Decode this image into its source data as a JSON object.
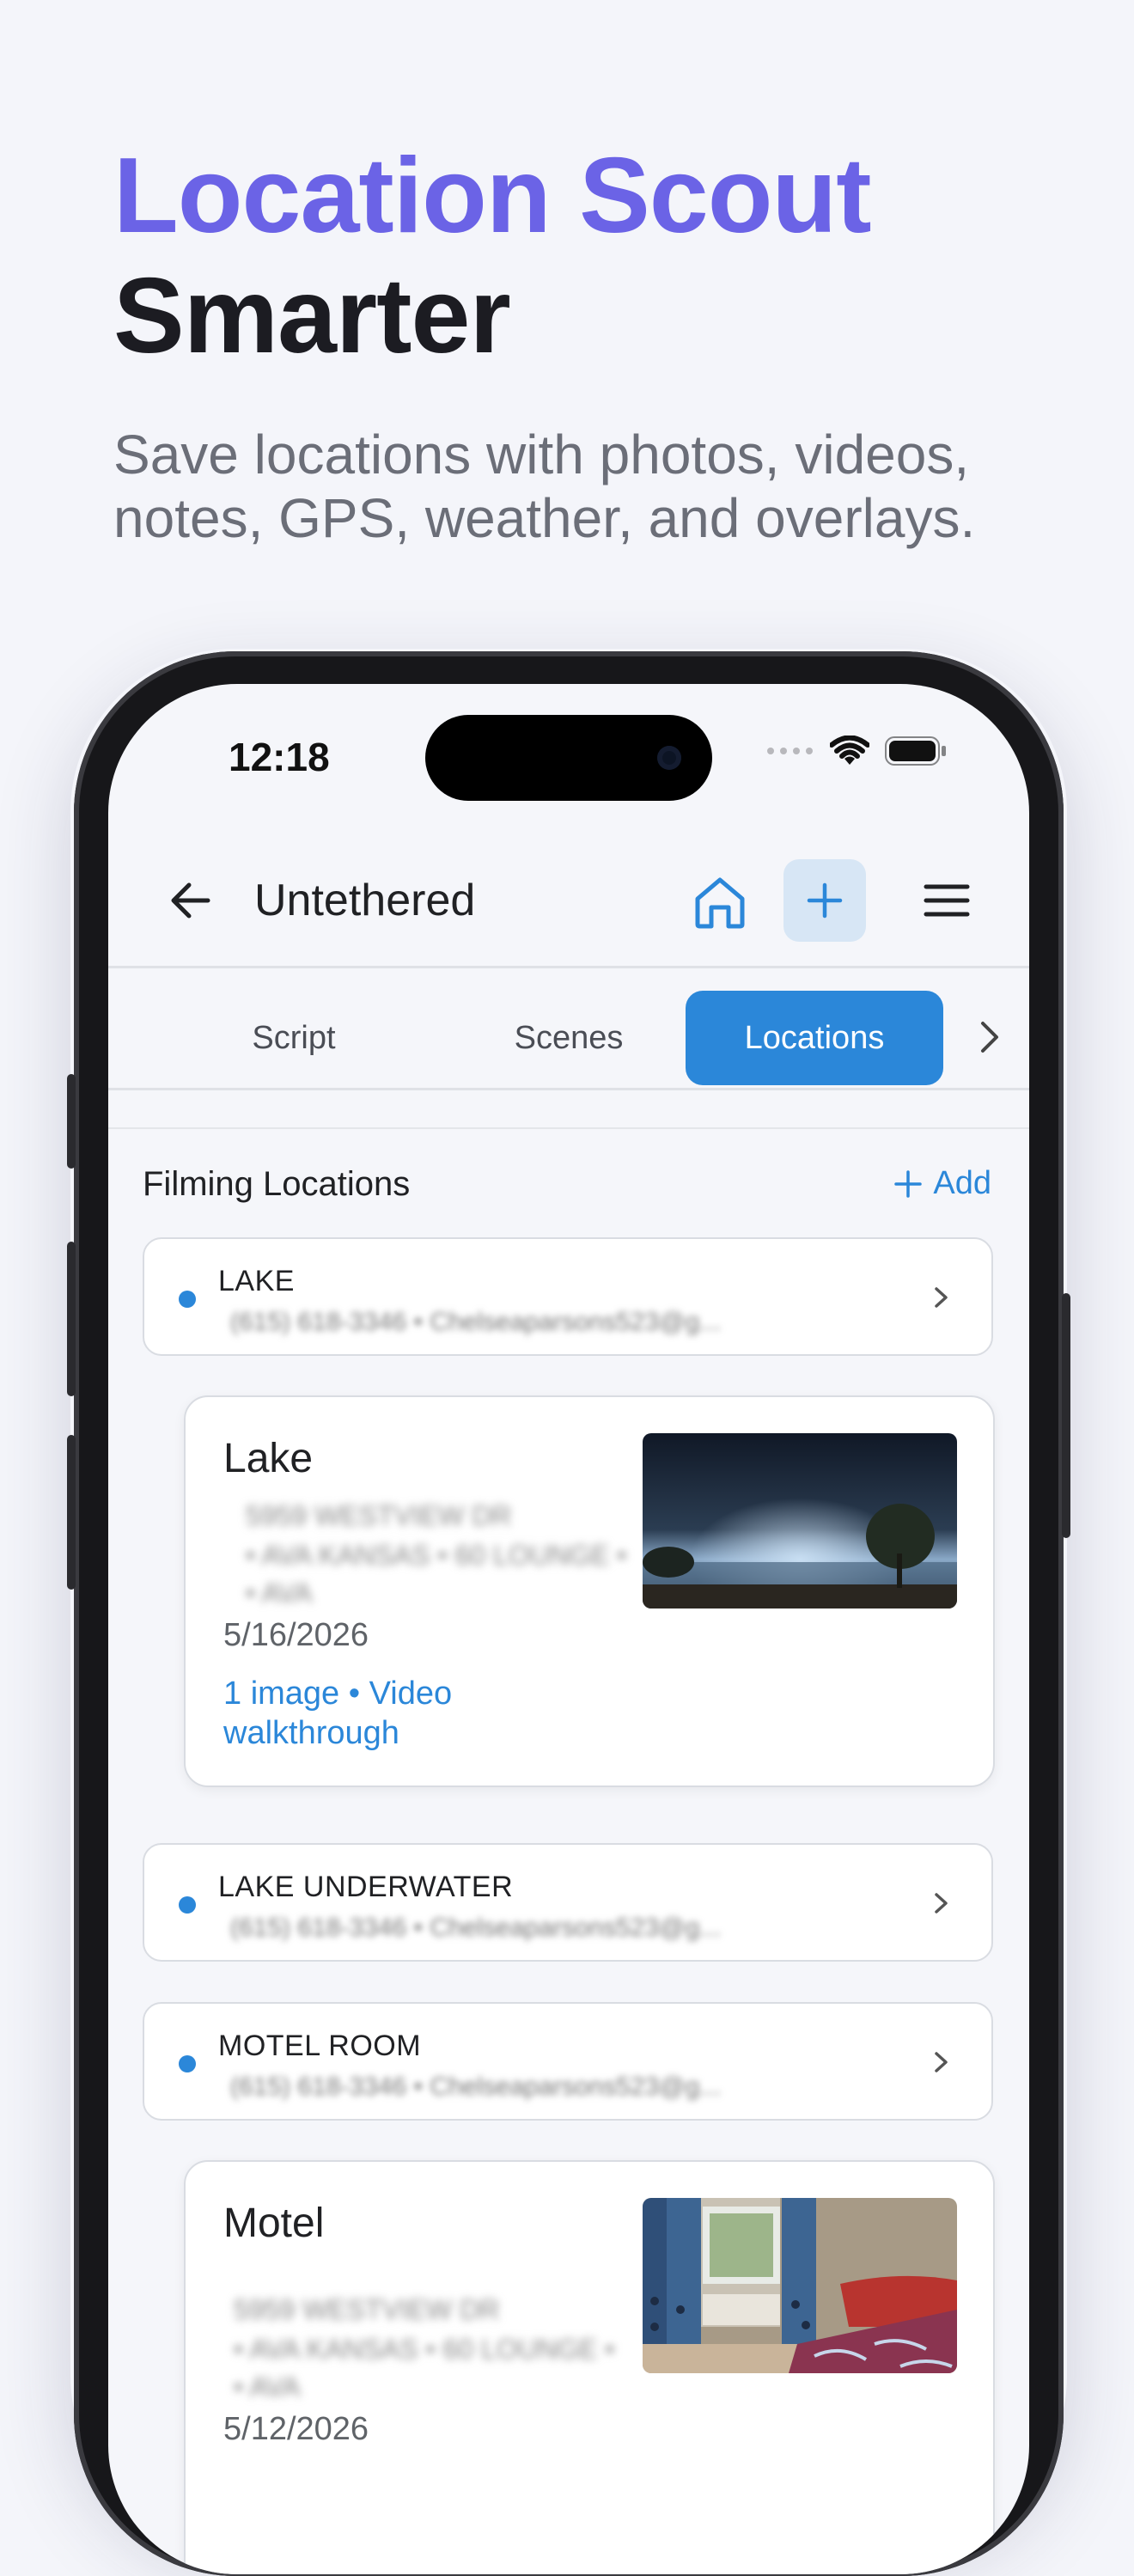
{
  "promo": {
    "headline_accent": "Location Scout",
    "headline_rest": "Smarter",
    "subhead": "Save locations with photos, videos, notes, GPS, weather, and overlays."
  },
  "status_bar": {
    "time": "12:18"
  },
  "app_bar": {
    "title": "Untethered"
  },
  "tabs": [
    {
      "label": "Script",
      "active": false
    },
    {
      "label": "Scenes",
      "active": false
    },
    {
      "label": "Locations",
      "active": true
    }
  ],
  "section": {
    "title": "Filming Locations",
    "add_label": "Add"
  },
  "locations": [
    {
      "name": "LAKE",
      "sub": "(615) 618-3346 • Chelseaparsons523@g..."
    },
    {
      "name": "LAKE UNDERWATER",
      "sub": "(615) 618-3346 • Chelseaparsons523@g..."
    },
    {
      "name": "MOTEL ROOM",
      "sub": "(615) 618-3346 • Chelseaparsons523@g..."
    }
  ],
  "cards": [
    {
      "title": "Lake",
      "blur_line1": "5959 WESTVIEW DR",
      "blur_line2": "• AVA KANSAS • 60 LOUNGE •",
      "blur_line3": "• AVA",
      "date": "5/16/2026",
      "meta": "1 image • Video walkthrough",
      "thumb": "lake-night-photo"
    },
    {
      "title": "Motel",
      "blur_line1": "5959 WESTVIEW DR",
      "blur_line2": "• AVA KANSAS • 60 LOUNGE •",
      "blur_line3": "• AVA",
      "date": "5/12/2026",
      "thumb": "motel-room-photo"
    }
  ],
  "colors": {
    "accent": "#6b63e6",
    "primary": "#2b87d9",
    "background": "#f4f5fa"
  }
}
